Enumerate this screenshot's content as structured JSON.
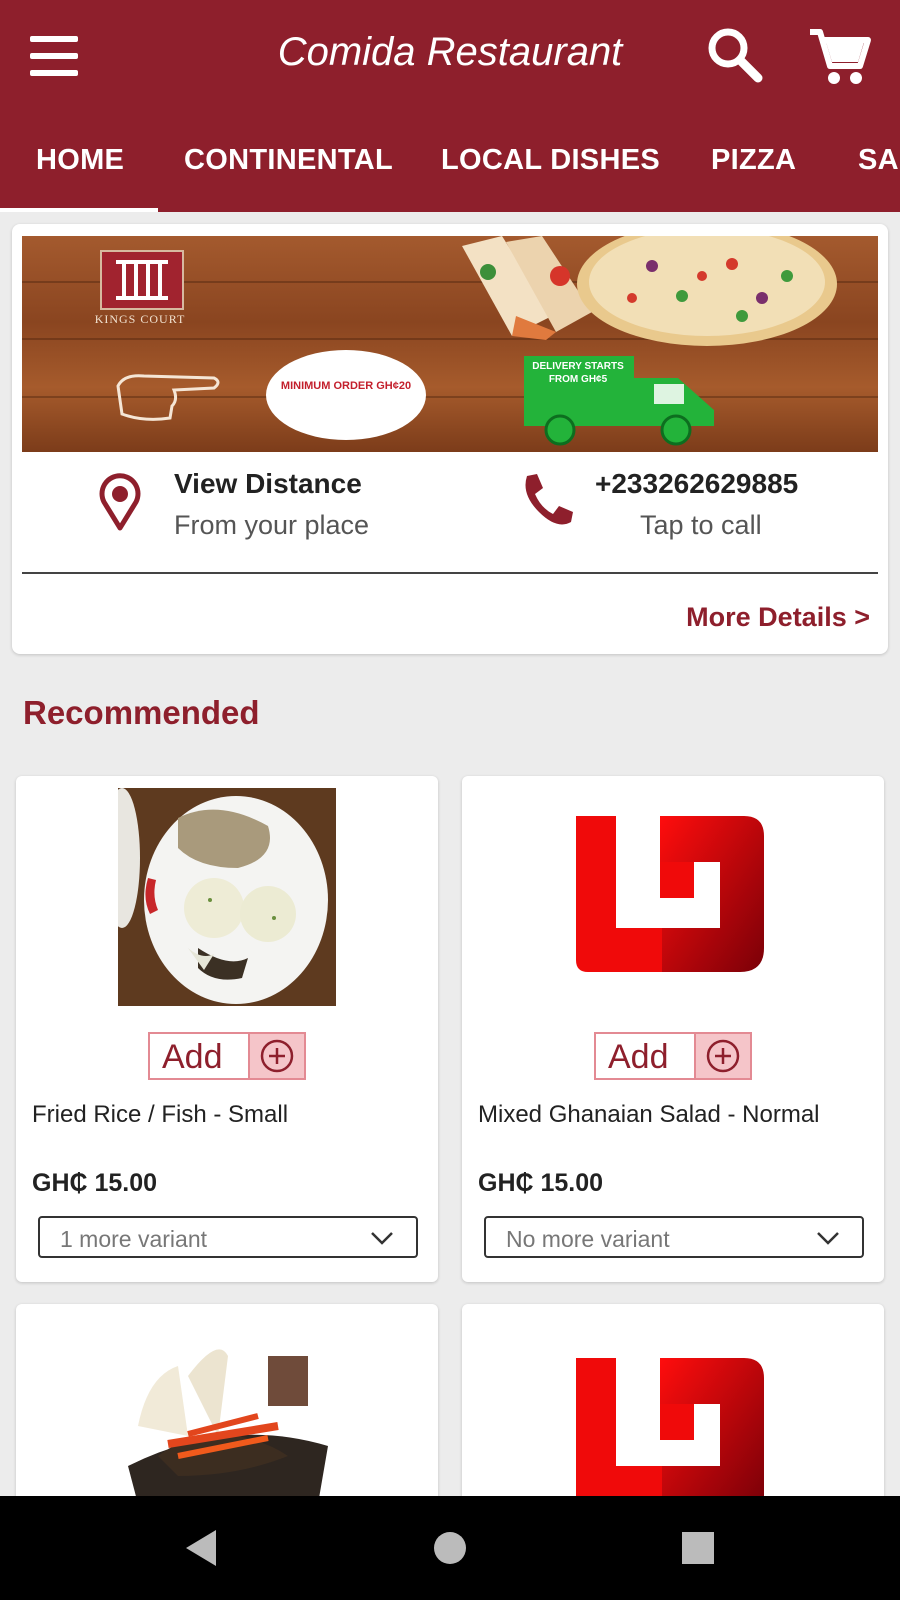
{
  "header": {
    "title": "Comida Restaurant",
    "menu_icon": "hamburger-menu-icon",
    "search_icon": "search-icon",
    "cart_icon": "cart-icon"
  },
  "tabs": [
    {
      "label": "HOME",
      "active": true
    },
    {
      "label": "CONTINENTAL"
    },
    {
      "label": "LOCAL DISHES"
    },
    {
      "label": "PIZZA"
    },
    {
      "label": "SA"
    }
  ],
  "info": {
    "banner": {
      "brand": "KINGS COURT",
      "min_order": "MINIMUM ORDER GH¢20",
      "delivery": "DELIVERY STARTS FROM GH¢5"
    },
    "distance": {
      "title": "View Distance",
      "subtitle": "From your place"
    },
    "phone": {
      "number": "+233262629885",
      "subtitle": "Tap to call"
    },
    "more_details": "More Details >"
  },
  "recommended": {
    "title": "Recommended",
    "add_label": "Add",
    "items": [
      {
        "name": "Fried Rice / Fish - Small",
        "price": "GH₵ 15.00",
        "variant": "1 more variant"
      },
      {
        "name": "Mixed Ghanaian Salad - Normal",
        "price": "GH₵ 15.00",
        "variant": "No more variant"
      }
    ]
  },
  "colors": {
    "primary": "#8e1f2c",
    "accent_light": "#f5c5c9",
    "background": "#ececec"
  }
}
